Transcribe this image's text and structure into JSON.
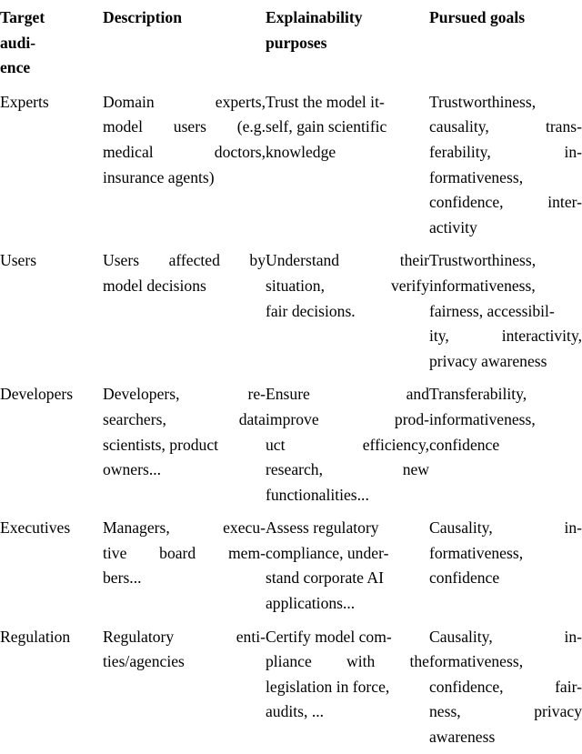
{
  "table": {
    "columns": [
      {
        "id": "target_audience",
        "header_lines": [
          "Target",
          "audi-",
          "ence"
        ]
      },
      {
        "id": "description",
        "header_lines": [
          "Description"
        ]
      },
      {
        "id": "explainability_purposes",
        "header_lines": [
          "Explainability",
          "purposes"
        ]
      },
      {
        "id": "pursued_goals",
        "header_lines": [
          "Pursued goals"
        ]
      }
    ],
    "rows": [
      {
        "target_audience": {
          "text": "Experts",
          "lines": [
            [
              "Experts"
            ]
          ]
        },
        "description": {
          "text": "Domain experts, model users (e.g. medical doctors, insurance agents)",
          "lines": [
            [
              "Domain",
              "experts,"
            ],
            [
              "model",
              "users",
              "(e.g."
            ],
            [
              "medical",
              "doctors,"
            ],
            [
              "insurance agents)"
            ]
          ]
        },
        "explainability_purposes": {
          "text": "Trust the model itself, gain scientific knowledge",
          "lines": [
            [
              "Trust the model it-"
            ],
            [
              "self, gain scientific"
            ],
            [
              "knowledge"
            ]
          ]
        },
        "pursued_goals": {
          "text": "Trustworthiness, causality, transferability, informativeness, confidence, interactivity",
          "lines": [
            [
              "Trustworthiness,"
            ],
            [
              "causality,",
              "trans-"
            ],
            [
              "ferability,",
              "in-"
            ],
            [
              "formativeness,"
            ],
            [
              "confidence,",
              "inter-"
            ],
            [
              "activity"
            ]
          ]
        }
      },
      {
        "target_audience": {
          "text": "Users",
          "lines": [
            [
              "Users"
            ]
          ]
        },
        "description": {
          "text": "Users affected by model decisions",
          "lines": [
            [
              "Users",
              "affected",
              "by"
            ],
            [
              "model decisions"
            ]
          ]
        },
        "explainability_purposes": {
          "text": "Understand their situation, verify fair decisions.",
          "lines": [
            [
              "Understand",
              "their"
            ],
            [
              "situation,",
              "verify"
            ],
            [
              "fair decisions."
            ]
          ]
        },
        "pursued_goals": {
          "text": "Trustworthiness, informativeness, fairness, accessibility, interactivity, privacy awareness",
          "lines": [
            [
              "Trustworthiness,"
            ],
            [
              "informativeness,"
            ],
            [
              "fairness, accessibil-"
            ],
            [
              "ity,",
              "interactivity,"
            ],
            [
              "privacy awareness"
            ]
          ]
        }
      },
      {
        "target_audience": {
          "text": "Developers",
          "lines": [
            [
              "Developers"
            ]
          ]
        },
        "description": {
          "text": "Developers, researchers, data scientists, product owners...",
          "lines": [
            [
              "Developers,",
              "re-"
            ],
            [
              "searchers,",
              "data"
            ],
            [
              "scientists, product"
            ],
            [
              "owners..."
            ]
          ]
        },
        "explainability_purposes": {
          "text": "Ensure and improve product efficiency, research, new functionalities...",
          "lines": [
            [
              "Ensure",
              "and"
            ],
            [
              "improve",
              "prod-"
            ],
            [
              "uct",
              "efficiency,"
            ],
            [
              "research,",
              "new"
            ],
            [
              "functionalities..."
            ]
          ]
        },
        "pursued_goals": {
          "text": "Transferability, informativeness, confidence",
          "lines": [
            [
              "Transferability,"
            ],
            [
              "informativeness,"
            ],
            [
              "confidence"
            ]
          ]
        }
      },
      {
        "target_audience": {
          "text": "Executives",
          "lines": [
            [
              "Executives"
            ]
          ]
        },
        "description": {
          "text": "Managers, executive board members...",
          "lines": [
            [
              "Managers,",
              "execu-"
            ],
            [
              "tive",
              "board",
              "mem-"
            ],
            [
              "bers..."
            ]
          ]
        },
        "explainability_purposes": {
          "text": "Assess regulatory compliance, understand corporate AI applications...",
          "lines": [
            [
              "Assess regulatory"
            ],
            [
              "compliance, under-"
            ],
            [
              "stand corporate AI"
            ],
            [
              "applications..."
            ]
          ]
        },
        "pursued_goals": {
          "text": "Causality, informativeness, confidence",
          "lines": [
            [
              "Causality,",
              "in-"
            ],
            [
              "formativeness,"
            ],
            [
              "confidence"
            ]
          ]
        }
      },
      {
        "target_audience": {
          "text": "Regulation",
          "lines": [
            [
              "Regulation"
            ]
          ]
        },
        "description": {
          "text": "Regulatory entities/agencies",
          "lines": [
            [
              "Regulatory",
              "enti-"
            ],
            [
              "ties/agencies"
            ]
          ]
        },
        "explainability_purposes": {
          "text": "Certify model compliance with the legislation in force, audits, ...",
          "lines": [
            [
              "Certify model com-"
            ],
            [
              "pliance",
              "with",
              "the"
            ],
            [
              "legislation in force,"
            ],
            [
              "audits, ..."
            ]
          ]
        },
        "pursued_goals": {
          "text": "Causality, informativeness, confidence, fairness, privacy awareness",
          "lines": [
            [
              "Causality,",
              "in-"
            ],
            [
              "formativeness,"
            ],
            [
              "confidence,",
              "fair-"
            ],
            [
              "ness,",
              "privacy"
            ],
            [
              "awareness"
            ]
          ]
        }
      }
    ]
  },
  "style": {
    "rule_color": "#111111",
    "text_color": "#000000",
    "background": "#ffffff"
  }
}
